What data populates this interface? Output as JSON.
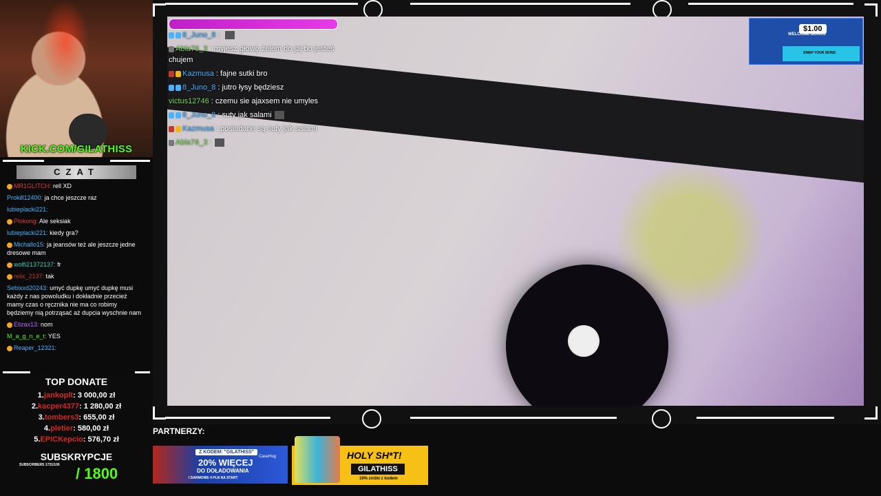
{
  "webcam": {
    "channel_url": "KICK.COM/GILATHISS"
  },
  "chat_panel": {
    "title": "CZAT",
    "messages": [
      {
        "user": "MR1GLITCH:",
        "text": "rell XD",
        "color": "#e23b3b",
        "badge": true
      },
      {
        "user": "Prokill12400:",
        "text": "ja chce jeszcze raz",
        "color": "#4ab3ff",
        "badge": false
      },
      {
        "user": "lubieplacki221:",
        "text": "",
        "color": "#4ab3ff",
        "badge": false
      },
      {
        "user": "Plokong:",
        "text": "Ale seksiak",
        "color": "#e23b3b",
        "badge": true
      },
      {
        "user": "lubieplacki221:",
        "text": "kiedy gra?",
        "color": "#4ab3ff",
        "badge": false
      },
      {
        "user": "Michallo15:",
        "text": "ja jeansów też ale jeszcze jedne dresowe mam",
        "color": "#4ab3ff",
        "badge": true
      },
      {
        "user": "wolfi21372137:",
        "text": "fr",
        "color": "#34d1b3",
        "badge": true
      },
      {
        "user": "reiix_2137:",
        "text": "tak",
        "color": "#c0392b",
        "badge": true
      },
      {
        "user": "Sebixxd20243:",
        "text": "umyć dupkę umyć dupkę musi każdy z nas powoludku i dokładnie przecież mamy czas o ręcznika nie ma co robimy będziemy nią potrząsać aż dupcia wyschnie nam",
        "color": "#4ab3ff",
        "badge": false
      },
      {
        "user": "Elizax13:",
        "text": "nom",
        "color": "#b36bff",
        "badge": true
      },
      {
        "user": "M_a_g_n_e_t:",
        "text": "YES",
        "color": "#53fc18",
        "badge": false
      },
      {
        "user": "Reaper_12321:",
        "text": "",
        "color": "#4ab3ff",
        "badge": true
      }
    ]
  },
  "top_donate": {
    "title": "TOP DONATE",
    "entries": [
      {
        "rank": "1.",
        "name": "jankoplt",
        "amount": ": 3 000,00 zł"
      },
      {
        "rank": "2.",
        "name": "kacper4377",
        "amount": ": 1 280,00 zł"
      },
      {
        "rank": "3.",
        "name": "tombers3",
        "amount": ": 655,00 zł"
      },
      {
        "rank": "4.",
        "name": "pletier",
        "amount": ": 580,00 zł"
      },
      {
        "rank": "5.",
        "name": "EPICKepcio",
        "amount": ": 576,70 zł"
      }
    ]
  },
  "subs": {
    "title": "SUBSKRYPCJE",
    "small": "SUBSCRIBERS 1731/100",
    "goal": "/ 1800"
  },
  "partners": {
    "label": "PARTNERZY:",
    "ad1": {
      "code": "Z KODEM: \"GILATHISS\"",
      "big": "20% WIĘCEJ",
      "line2": "DO DOŁADOWANIA",
      "line3": "I DARMOWE 4 PLN NA START",
      "brand": "CaseHug"
    },
    "ad2": {
      "headline": "HOLY SH*T!",
      "code": "GILATHISS",
      "discount": "10% zniżki z kodem"
    }
  },
  "overlay_chat": [
    {
      "user": "8_Juno_8",
      "text": "",
      "color": "#4ab3ff",
      "badges": [
        "b-blue",
        "b-blue"
      ]
    },
    {
      "user": "Abla76_3",
      "text": ": myjesz głowę żelem do jaj bo jesteś chujem",
      "color": "#7ad957",
      "badges": [
        "b-grey"
      ]
    },
    {
      "user": "Kazmusa",
      "text": ": fajne sutki bro",
      "color": "#4ab3ff",
      "badges": [
        "b-red",
        "b-gold"
      ]
    },
    {
      "user": "8_Juno_8",
      "text": ": jutro łysy będziesz",
      "color": "#4ab3ff",
      "badges": [
        "b-blue",
        "b-blue"
      ]
    },
    {
      "user": "victus12746",
      "text": ": czemu sie ajaxsem nie umyles",
      "color": "#7ad957",
      "badges": []
    },
    {
      "user": "8_Juno_8",
      "text": ": suty jak salami",
      "color": "#4ab3ff",
      "badges": [
        "b-blue",
        "b-blue"
      ]
    },
    {
      "user": "Kazmusa",
      "text": ": posiadane są suty jak salami",
      "color": "#4ab3ff",
      "badges": [
        "b-red",
        "b-gold"
      ]
    },
    {
      "user": "Abla76_3",
      "text": ":",
      "color": "#7ad957",
      "badges": [
        "b-grey"
      ]
    }
  ],
  "promo": {
    "amount": "$1.00",
    "label": "WELCOME BONUS",
    "swap": "SWAP YOUR SKINS"
  },
  "colors": {
    "kick_green": "#53fc18",
    "donor_red": "#d62828"
  }
}
